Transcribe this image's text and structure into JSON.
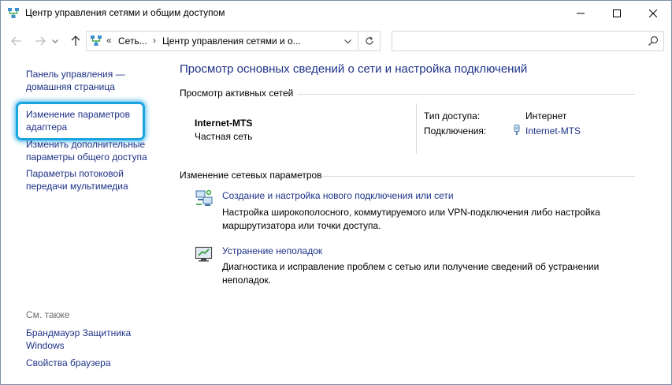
{
  "window": {
    "title": "Центр управления сетями и общим доступом",
    "minimize_icon": "minimize-icon",
    "maximize_icon": "maximize-icon",
    "close_icon": "close-icon"
  },
  "navigation": {
    "back_icon": "arrow-left-icon",
    "forward_icon": "arrow-right-icon",
    "dropdown_icon": "chevron-down-icon",
    "up_icon": "arrow-up-icon"
  },
  "address": {
    "breadcrumbs": [
      "Сеть...",
      "Центр управления сетями и о..."
    ],
    "chevron": "«",
    "separator": "›"
  },
  "search": {
    "placeholder": "",
    "icon": "search-icon"
  },
  "sidebar": {
    "home_link": [
      "Панель управления —",
      "домашняя страница"
    ],
    "items": [
      {
        "lines": [
          "Изменение параметров",
          "адаптера"
        ],
        "highlighted": true
      },
      {
        "lines": [
          "Изменить дополнительные",
          "параметры общего доступа"
        ]
      },
      {
        "lines": [
          "Параметры потоковой",
          "передачи мультимедиа"
        ]
      }
    ],
    "see_also_label": "См. также",
    "see_also": [
      {
        "lines": [
          "Брандмауэр Защитника",
          "Windows"
        ]
      },
      {
        "lines": [
          "Свойства браузера"
        ]
      }
    ],
    "highlight_color": "#1aa4e0"
  },
  "main": {
    "title": "Просмотр основных сведений о сети и настройка подключений",
    "active_networks_header": "Просмотр активных сетей",
    "network": {
      "name": "Internet-MTS",
      "category": "Частная сеть",
      "access_type_label": "Тип доступа:",
      "access_type_value": "Интернет",
      "connections_label": "Подключения:",
      "connections_value": "Internet-MTS"
    },
    "change_settings_header": "Изменение сетевых параметров",
    "tasks": [
      {
        "link": "Создание и настройка нового подключения или сети",
        "description": "Настройка широкополосного, коммутируемого или VPN-подключения либо настройка маршрутизатора или точки доступа.",
        "icon": "new-connection-icon"
      },
      {
        "link": "Устранение неполадок",
        "description": "Диагностика и исправление проблем с сетью или получение сведений об устранении неполадок.",
        "icon": "troubleshoot-icon"
      }
    ]
  },
  "colors": {
    "link": "#1e3287",
    "accent": "#1aa4e0"
  }
}
